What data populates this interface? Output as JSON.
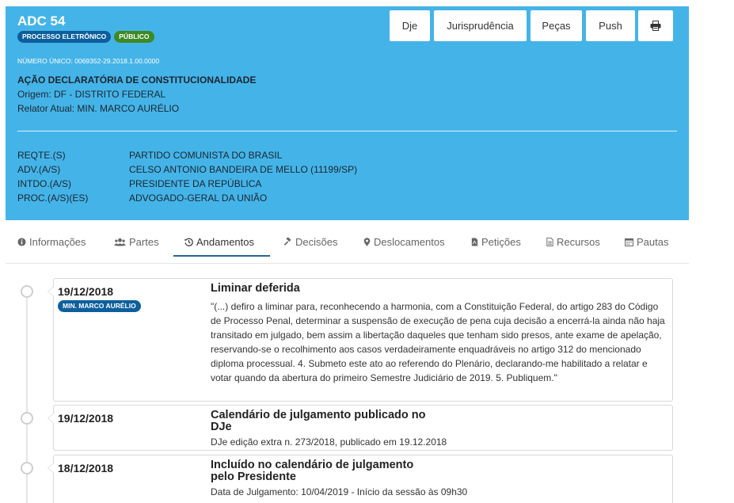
{
  "header": {
    "title": "ADC 54",
    "badges": [
      "PROCESSO ELETRÔNICO",
      "PÚBLICO"
    ],
    "numero_unico": "NÚMERO ÚNICO: 0069352-29.2018.1.00.0000",
    "classe": "AÇÃO DECLARATÓRIA DE CONSTITUCIONALIDADE",
    "origem": "Origem: DF - DISTRITO FEDERAL",
    "relator": "Relator Atual: MIN. MARCO AURÉLIO",
    "buttons": [
      "Dje",
      "Jurisprudência",
      "Peças",
      "Push"
    ],
    "print_icon": "printer-icon",
    "parties": [
      {
        "label": "REQTE.(S)",
        "value": "PARTIDO COMUNISTA DO BRASIL"
      },
      {
        "label": "ADV.(A/S)",
        "value": "CELSO ANTONIO BANDEIRA DE MELLO (11199/SP)"
      },
      {
        "label": "INTDO.(A/S)",
        "value": "PRESIDENTE DA REPÚBLICA"
      },
      {
        "label": "PROC.(A/S)(ES)",
        "value": "ADVOGADO-GERAL DA UNIÃO"
      }
    ]
  },
  "tabs": [
    {
      "label": "Informações",
      "icon": "info-circle-icon"
    },
    {
      "label": "Partes",
      "icon": "users-icon"
    },
    {
      "label": "Andamentos",
      "icon": "history-icon",
      "active": true
    },
    {
      "label": "Decisões",
      "icon": "gavel-icon"
    },
    {
      "label": "Deslocamentos",
      "icon": "map-marker-icon"
    },
    {
      "label": "Petições",
      "icon": "pdf-file-icon"
    },
    {
      "label": "Recursos",
      "icon": "file-text-icon"
    },
    {
      "label": "Pautas",
      "icon": "calendar-icon"
    }
  ],
  "andamentos": [
    {
      "date": "19/12/2018",
      "badge": "MIN. MARCO AURÉLIO",
      "title": "Liminar deferida",
      "text": "\"(...) defiro a liminar para, reconhecendo a harmonia, com a Constituição Federal, do artigo 283 do Código de Processo Penal, determinar a suspensão de execução de pena cuja decisão a encerrá-la ainda não haja transitado em julgado, bem assim a libertação daqueles que tenham sido presos, ante exame de apelação, reservando-se o recolhimento aos casos verdadeiramente enquadráveis no artigo 312 do mencionado diploma processual. 4. Submeto este ato ao referendo do Plenário, declarando-me habilitado a relatar e votar quando da abertura do primeiro Semestre Judiciário de 2019. 5. Publiquem.\""
    },
    {
      "date": "19/12/2018",
      "title_line1": "Calendário de julgamento publicado no",
      "title_line2": "DJe",
      "text": "DJe edição extra n. 273/2018, publicado em 19.12.2018"
    },
    {
      "date": "18/12/2018",
      "title_line1": "Incluído no calendário de julgamento",
      "title_line2": "pelo Presidente",
      "text": "Data de Julgamento: 10/04/2019 - Início da sessão às 09h30"
    }
  ]
}
